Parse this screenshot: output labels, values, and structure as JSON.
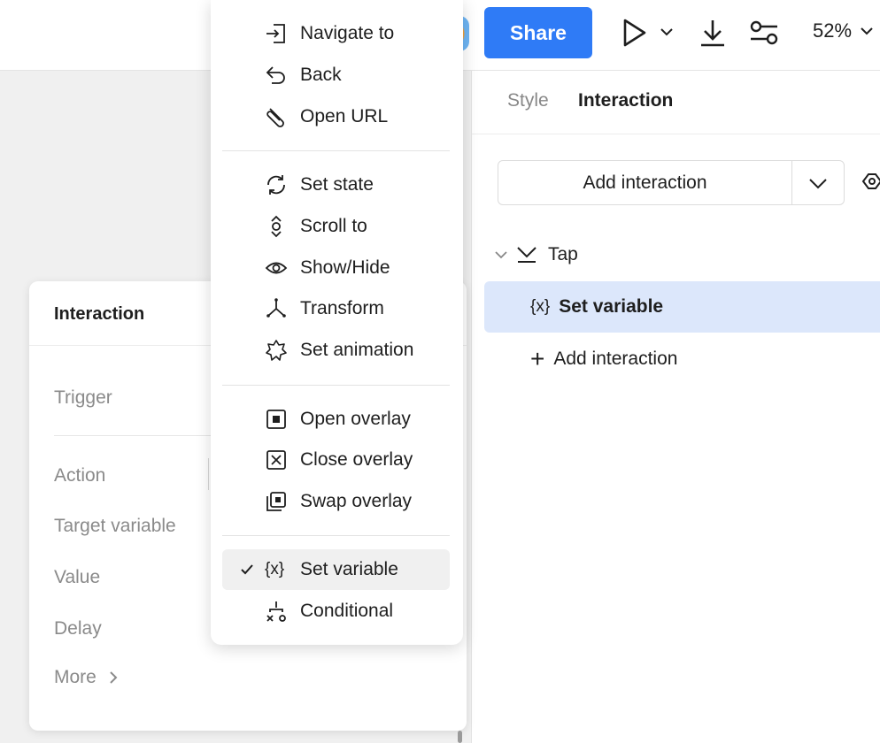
{
  "topbar": {
    "share_label": "Share",
    "zoom_label": "52%"
  },
  "right_panel": {
    "tabs": [
      {
        "label": "Style",
        "active": false
      },
      {
        "label": "Interaction",
        "active": true
      }
    ],
    "add_interaction_label": "Add interaction",
    "trigger_label": "Tap",
    "selected_action_label": "Set variable",
    "add_interaction_row_label": "Add interaction"
  },
  "interaction_card": {
    "title": "Interaction",
    "rows": {
      "trigger": "Trigger",
      "action": "Action",
      "target_variable": "Target variable",
      "value": "Value",
      "delay": "Delay",
      "more": "More"
    }
  },
  "menu": {
    "items": [
      {
        "label": "Navigate to",
        "icon": "navigate-icon"
      },
      {
        "label": "Back",
        "icon": "back-icon"
      },
      {
        "label": "Open URL",
        "icon": "link-icon"
      },
      {
        "label": "Set state",
        "icon": "refresh-icon"
      },
      {
        "label": "Scroll to",
        "icon": "scroll-icon"
      },
      {
        "label": "Show/Hide",
        "icon": "eye-icon"
      },
      {
        "label": "Transform",
        "icon": "transform-icon"
      },
      {
        "label": "Set animation",
        "icon": "animation-icon"
      },
      {
        "label": "Open overlay",
        "icon": "open-overlay-icon"
      },
      {
        "label": "Close overlay",
        "icon": "close-overlay-icon"
      },
      {
        "label": "Swap overlay",
        "icon": "swap-overlay-icon"
      },
      {
        "label": "Set variable",
        "icon": "variable-icon",
        "selected": true
      },
      {
        "label": "Conditional",
        "icon": "conditional-icon"
      }
    ]
  },
  "colors": {
    "accent": "#2f7bf6",
    "selected_row": "#dce7fb"
  }
}
